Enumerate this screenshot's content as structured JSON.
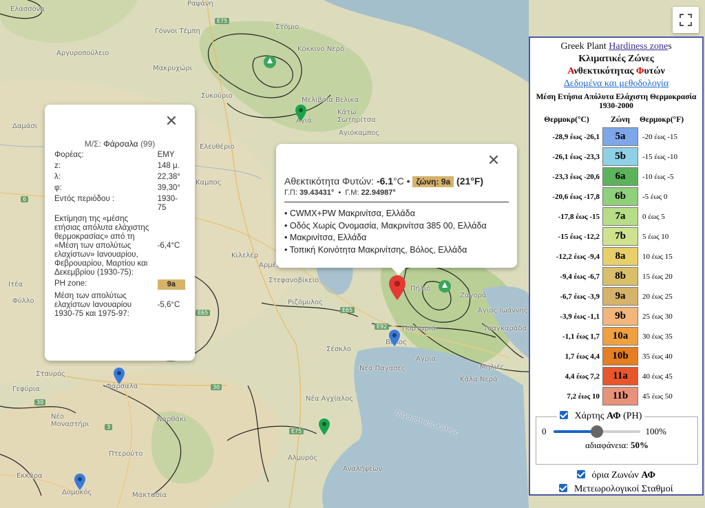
{
  "map": {
    "places": [
      {
        "name": "Ελασσόνα"
      },
      {
        "name": "Ραψάνη"
      },
      {
        "name": "Γόννοι Τέμπη"
      },
      {
        "name": "Στόμιο"
      },
      {
        "name": "Αργυροπούλειο"
      },
      {
        "name": "Κόκκινο Νερό"
      },
      {
        "name": "Μακρυχώρι"
      },
      {
        "name": "Συκούριο"
      },
      {
        "name": "Μελιβοία Βελικα"
      },
      {
        "name": "Κάτω Σωτηρίτσα"
      },
      {
        "name": "Αγιόκαμπος"
      },
      {
        "name": "Αγιά"
      },
      {
        "name": "Δαμάσι"
      },
      {
        "name": "Ελευθέριο"
      },
      {
        "name": "Καμπος"
      },
      {
        "name": "Κιλελέρ"
      },
      {
        "name": "Αρμένιο"
      },
      {
        "name": "Στεφανοβίκειο"
      },
      {
        "name": "Ριζόμυλος"
      },
      {
        "name": "Ζαγορά"
      },
      {
        "name": "Πήλιο"
      },
      {
        "name": "Άγιος Ιωάννης"
      },
      {
        "name": "Πορταριά"
      },
      {
        "name": "Βόλος"
      },
      {
        "name": "Τσαγκαράδα"
      },
      {
        "name": "Αγρια"
      },
      {
        "name": "Σέσκλο"
      },
      {
        "name": "Νέα Παγασές"
      },
      {
        "name": "Μηλιές"
      },
      {
        "name": "Κάλα Νερά"
      },
      {
        "name": "Ιτέα"
      },
      {
        "name": "Φύλλο"
      },
      {
        "name": "Σταυρός"
      },
      {
        "name": "Φάρσαλα"
      },
      {
        "name": "Γεφύρια"
      },
      {
        "name": "Νέα Αγχίαλος"
      },
      {
        "name": "Νέο Μοναστήρι"
      },
      {
        "name": "Ναρθάκι"
      },
      {
        "name": "Αλμυρός"
      },
      {
        "name": "Πτερούτο"
      },
      {
        "name": "Εκκάρα"
      },
      {
        "name": "Δομοκός"
      },
      {
        "name": "Μακτασία"
      },
      {
        "name": "Αναλήψεων"
      },
      {
        "name": "Παγασητικός Κόλπος"
      }
    ],
    "roads": [
      "E75",
      "E92",
      "E65",
      "6",
      "30",
      "3",
      "E75",
      "30",
      "E65"
    ]
  },
  "info_left": {
    "title_prefix": "Μ/Σ:",
    "station": "Φάρσαλα",
    "station_id": "(99)",
    "rows": [
      {
        "label": "Φορέας:",
        "value": "ΕΜΥ"
      },
      {
        "label": "z:",
        "value": "148 μ."
      },
      {
        "label": "λ:",
        "value": "22,38°"
      },
      {
        "label": "φ:",
        "value": "39,30°"
      },
      {
        "label": "Εντός περιόδου :",
        "value": "1930-75"
      },
      {
        "label": "Εκτίμηση της «μέσης ετήσιας απόλυτα ελάχιστης θερμοκρασίας» από τη «Μέση των απολύτως ελαχίστων» Ιανουαρίου, Φεβρουαρίου, Μαρτίου και Δεκεμβρίου (1930-75):",
        "value": "-6,4°C"
      },
      {
        "label": "PH zone:",
        "value": "9a",
        "chip": true
      },
      {
        "label": "Μέση των απολύτως ελαχίστων Ιανουαρίου 1930-75 και 1975-97:",
        "value": "-5,6°C"
      }
    ]
  },
  "info_right": {
    "label": "Αθεκτικότητα Φυτών:",
    "temp": "-6.1",
    "unit_c": "°C",
    "sep": "•",
    "zone": "ζώνη: 9a",
    "temp_f": "(21°F)",
    "lat_label": "Γ.Π:",
    "lat": "39.43431°",
    "lon_label": "Γ.Μ:",
    "lon": "22.94987°",
    "addresses": [
      "• CWMX+PW Μακρινίτσα, Ελλάδα",
      "• Οδός Χωρίς Ονομασία, Μακρινίτσα 385 00, Ελλάδα",
      "• Μακρινίτσα, Ελλάδα",
      "• Τοπική Κοινότητα Μακρινίτσης, Βόλος, Ελλάδα"
    ]
  },
  "legend": {
    "line1a": "Greek Plant ",
    "line1link": "Hardiness zone",
    "line1b": "s",
    "line2": "Κλιματικές Ζώνες",
    "line3a": "Α",
    "line3b": "νθεκτικότητας ",
    "line3c": "Φ",
    "line3d": "υτών",
    "line4": "Δεδομένα και μεθοδολογία",
    "subtitle": "Μέση Ετήσια Απόλυτα Ελάχιστη Θερμοκρασία 1930-2000",
    "col_c": "Θερμοκρ(°C)",
    "col_zone": "Ζώνη",
    "col_f": "Θερμοκρ(°F)",
    "zones": [
      {
        "c": "-28,9 έως -26,1",
        "zone": "5a",
        "f": "-20 έως -15",
        "color": "#7da7e8"
      },
      {
        "c": "-26,1 έως -23,3",
        "zone": "5b",
        "f": "-15 έως -10",
        "color": "#8ed1e6"
      },
      {
        "c": "-23,3 έως -20,6",
        "zone": "6a",
        "f": "-10 έως -5",
        "color": "#5cb35c"
      },
      {
        "c": "-20,6 έως -17,8",
        "zone": "6b",
        "f": "-5 έως 0",
        "color": "#8fd07a"
      },
      {
        "c": "-17,8 έως -15",
        "zone": "7a",
        "f": "0 έως 5",
        "color": "#b7dd88"
      },
      {
        "c": "-15 έως -12,2",
        "zone": "7b",
        "f": "5 έως 10",
        "color": "#cfe38e"
      },
      {
        "c": "-12,2 έως -9,4",
        "zone": "8a",
        "f": "10 έως 15",
        "color": "#e9cf6a"
      },
      {
        "c": "-9,4 έως -6,7",
        "zone": "8b",
        "f": "15 έως 20",
        "color": "#d9bf6a"
      },
      {
        "c": "-6,7 έως -3,9",
        "zone": "9a",
        "f": "20 έως 25",
        "color": "#d6b36b"
      },
      {
        "c": "-3,9 έως -1,1",
        "zone": "9b",
        "f": "25 έως 30",
        "color": "#f2b57a"
      },
      {
        "c": "-1,1 έως 1,7",
        "zone": "10a",
        "f": "30 έως 35",
        "color": "#f0a040"
      },
      {
        "c": "1,7 έως 4,4",
        "zone": "10b",
        "f": "35 έως 40",
        "color": "#e67e22"
      },
      {
        "c": "4,4 έως 7,2",
        "zone": "11a",
        "f": "40 έως 45",
        "color": "#e8562c"
      },
      {
        "c": "7,2 έως 10",
        "zone": "11b",
        "f": "45 έως 50",
        "color": "#e8927a"
      }
    ],
    "layer_label": "Χάρτης ",
    "layer_bold": "ΑΦ",
    "layer_suffix": " (PH)",
    "slider_min": "0",
    "slider_max": "100%",
    "opacity_value": 0.5,
    "opacity_label": "αδιαφάνεια: ",
    "opacity_text": "50%",
    "borders_label": "όρια Ζωνών ",
    "borders_bold": "ΑΦ",
    "stations_label": "Μετεωρολογικοί Σταθμοί"
  }
}
